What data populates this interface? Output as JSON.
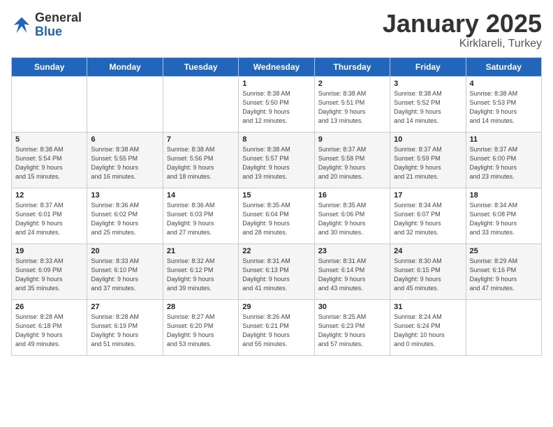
{
  "header": {
    "logo_general": "General",
    "logo_blue": "Blue",
    "month_title": "January 2025",
    "location": "Kirklareli, Turkey"
  },
  "days_of_week": [
    "Sunday",
    "Monday",
    "Tuesday",
    "Wednesday",
    "Thursday",
    "Friday",
    "Saturday"
  ],
  "weeks": [
    [
      {
        "day": "",
        "info": ""
      },
      {
        "day": "",
        "info": ""
      },
      {
        "day": "",
        "info": ""
      },
      {
        "day": "1",
        "info": "Sunrise: 8:38 AM\nSunset: 5:50 PM\nDaylight: 9 hours\nand 12 minutes."
      },
      {
        "day": "2",
        "info": "Sunrise: 8:38 AM\nSunset: 5:51 PM\nDaylight: 9 hours\nand 13 minutes."
      },
      {
        "day": "3",
        "info": "Sunrise: 8:38 AM\nSunset: 5:52 PM\nDaylight: 9 hours\nand 14 minutes."
      },
      {
        "day": "4",
        "info": "Sunrise: 8:38 AM\nSunset: 5:53 PM\nDaylight: 9 hours\nand 14 minutes."
      }
    ],
    [
      {
        "day": "5",
        "info": "Sunrise: 8:38 AM\nSunset: 5:54 PM\nDaylight: 9 hours\nand 15 minutes."
      },
      {
        "day": "6",
        "info": "Sunrise: 8:38 AM\nSunset: 5:55 PM\nDaylight: 9 hours\nand 16 minutes."
      },
      {
        "day": "7",
        "info": "Sunrise: 8:38 AM\nSunset: 5:56 PM\nDaylight: 9 hours\nand 18 minutes."
      },
      {
        "day": "8",
        "info": "Sunrise: 8:38 AM\nSunset: 5:57 PM\nDaylight: 9 hours\nand 19 minutes."
      },
      {
        "day": "9",
        "info": "Sunrise: 8:37 AM\nSunset: 5:58 PM\nDaylight: 9 hours\nand 20 minutes."
      },
      {
        "day": "10",
        "info": "Sunrise: 8:37 AM\nSunset: 5:59 PM\nDaylight: 9 hours\nand 21 minutes."
      },
      {
        "day": "11",
        "info": "Sunrise: 8:37 AM\nSunset: 6:00 PM\nDaylight: 9 hours\nand 23 minutes."
      }
    ],
    [
      {
        "day": "12",
        "info": "Sunrise: 8:37 AM\nSunset: 6:01 PM\nDaylight: 9 hours\nand 24 minutes."
      },
      {
        "day": "13",
        "info": "Sunrise: 8:36 AM\nSunset: 6:02 PM\nDaylight: 9 hours\nand 25 minutes."
      },
      {
        "day": "14",
        "info": "Sunrise: 8:36 AM\nSunset: 6:03 PM\nDaylight: 9 hours\nand 27 minutes."
      },
      {
        "day": "15",
        "info": "Sunrise: 8:35 AM\nSunset: 6:04 PM\nDaylight: 9 hours\nand 28 minutes."
      },
      {
        "day": "16",
        "info": "Sunrise: 8:35 AM\nSunset: 6:06 PM\nDaylight: 9 hours\nand 30 minutes."
      },
      {
        "day": "17",
        "info": "Sunrise: 8:34 AM\nSunset: 6:07 PM\nDaylight: 9 hours\nand 32 minutes."
      },
      {
        "day": "18",
        "info": "Sunrise: 8:34 AM\nSunset: 6:08 PM\nDaylight: 9 hours\nand 33 minutes."
      }
    ],
    [
      {
        "day": "19",
        "info": "Sunrise: 8:33 AM\nSunset: 6:09 PM\nDaylight: 9 hours\nand 35 minutes."
      },
      {
        "day": "20",
        "info": "Sunrise: 8:33 AM\nSunset: 6:10 PM\nDaylight: 9 hours\nand 37 minutes."
      },
      {
        "day": "21",
        "info": "Sunrise: 8:32 AM\nSunset: 6:12 PM\nDaylight: 9 hours\nand 39 minutes."
      },
      {
        "day": "22",
        "info": "Sunrise: 8:31 AM\nSunset: 6:13 PM\nDaylight: 9 hours\nand 41 minutes."
      },
      {
        "day": "23",
        "info": "Sunrise: 8:31 AM\nSunset: 6:14 PM\nDaylight: 9 hours\nand 43 minutes."
      },
      {
        "day": "24",
        "info": "Sunrise: 8:30 AM\nSunset: 6:15 PM\nDaylight: 9 hours\nand 45 minutes."
      },
      {
        "day": "25",
        "info": "Sunrise: 8:29 AM\nSunset: 6:16 PM\nDaylight: 9 hours\nand 47 minutes."
      }
    ],
    [
      {
        "day": "26",
        "info": "Sunrise: 8:28 AM\nSunset: 6:18 PM\nDaylight: 9 hours\nand 49 minutes."
      },
      {
        "day": "27",
        "info": "Sunrise: 8:28 AM\nSunset: 6:19 PM\nDaylight: 9 hours\nand 51 minutes."
      },
      {
        "day": "28",
        "info": "Sunrise: 8:27 AM\nSunset: 6:20 PM\nDaylight: 9 hours\nand 53 minutes."
      },
      {
        "day": "29",
        "info": "Sunrise: 8:26 AM\nSunset: 6:21 PM\nDaylight: 9 hours\nand 55 minutes."
      },
      {
        "day": "30",
        "info": "Sunrise: 8:25 AM\nSunset: 6:23 PM\nDaylight: 9 hours\nand 57 minutes."
      },
      {
        "day": "31",
        "info": "Sunrise: 8:24 AM\nSunset: 6:24 PM\nDaylight: 10 hours\nand 0 minutes."
      },
      {
        "day": "",
        "info": ""
      }
    ]
  ]
}
